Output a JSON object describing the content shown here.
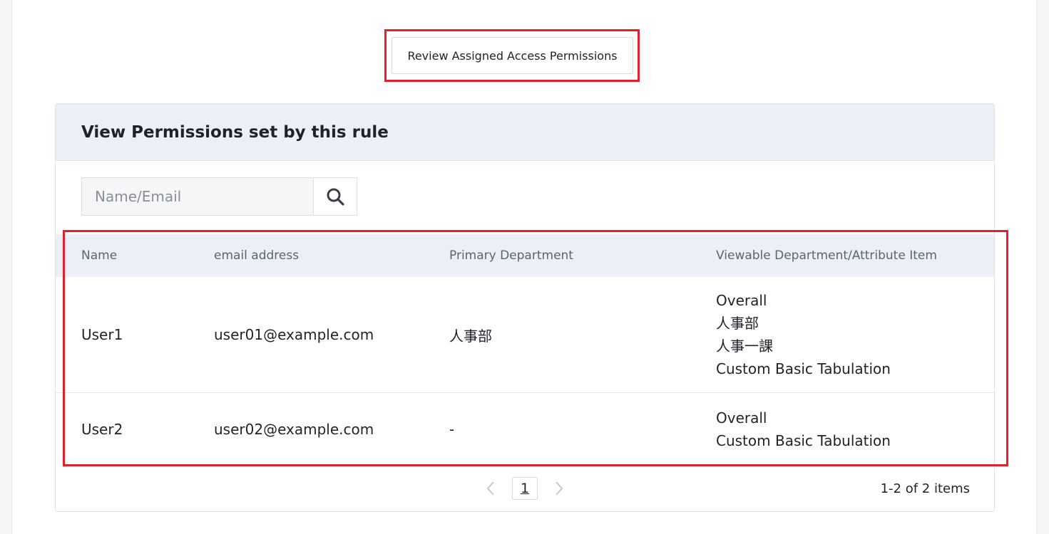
{
  "review_button": {
    "label": "Review Assigned Access Permissions"
  },
  "panel": {
    "title": "View Permissions set by this rule",
    "search": {
      "placeholder": "Name/Email",
      "value": ""
    },
    "table": {
      "columns": [
        "Name",
        "email address",
        "Primary Department",
        "Viewable Department/Attribute Item"
      ],
      "rows": [
        {
          "name": "User1",
          "email": "user01@example.com",
          "primary_department": "人事部",
          "viewable": [
            "Overall",
            "人事部",
            "人事一課",
            "Custom Basic Tabulation"
          ]
        },
        {
          "name": "User2",
          "email": "user02@example.com",
          "primary_department": "-",
          "viewable": [
            "Overall",
            "Custom Basic Tabulation"
          ]
        }
      ]
    },
    "pagination": {
      "current_page": "1",
      "info": "1-2 of 2 items"
    }
  },
  "colors": {
    "annotation": "#e3202b",
    "header_bg": "#ebf0f7"
  }
}
